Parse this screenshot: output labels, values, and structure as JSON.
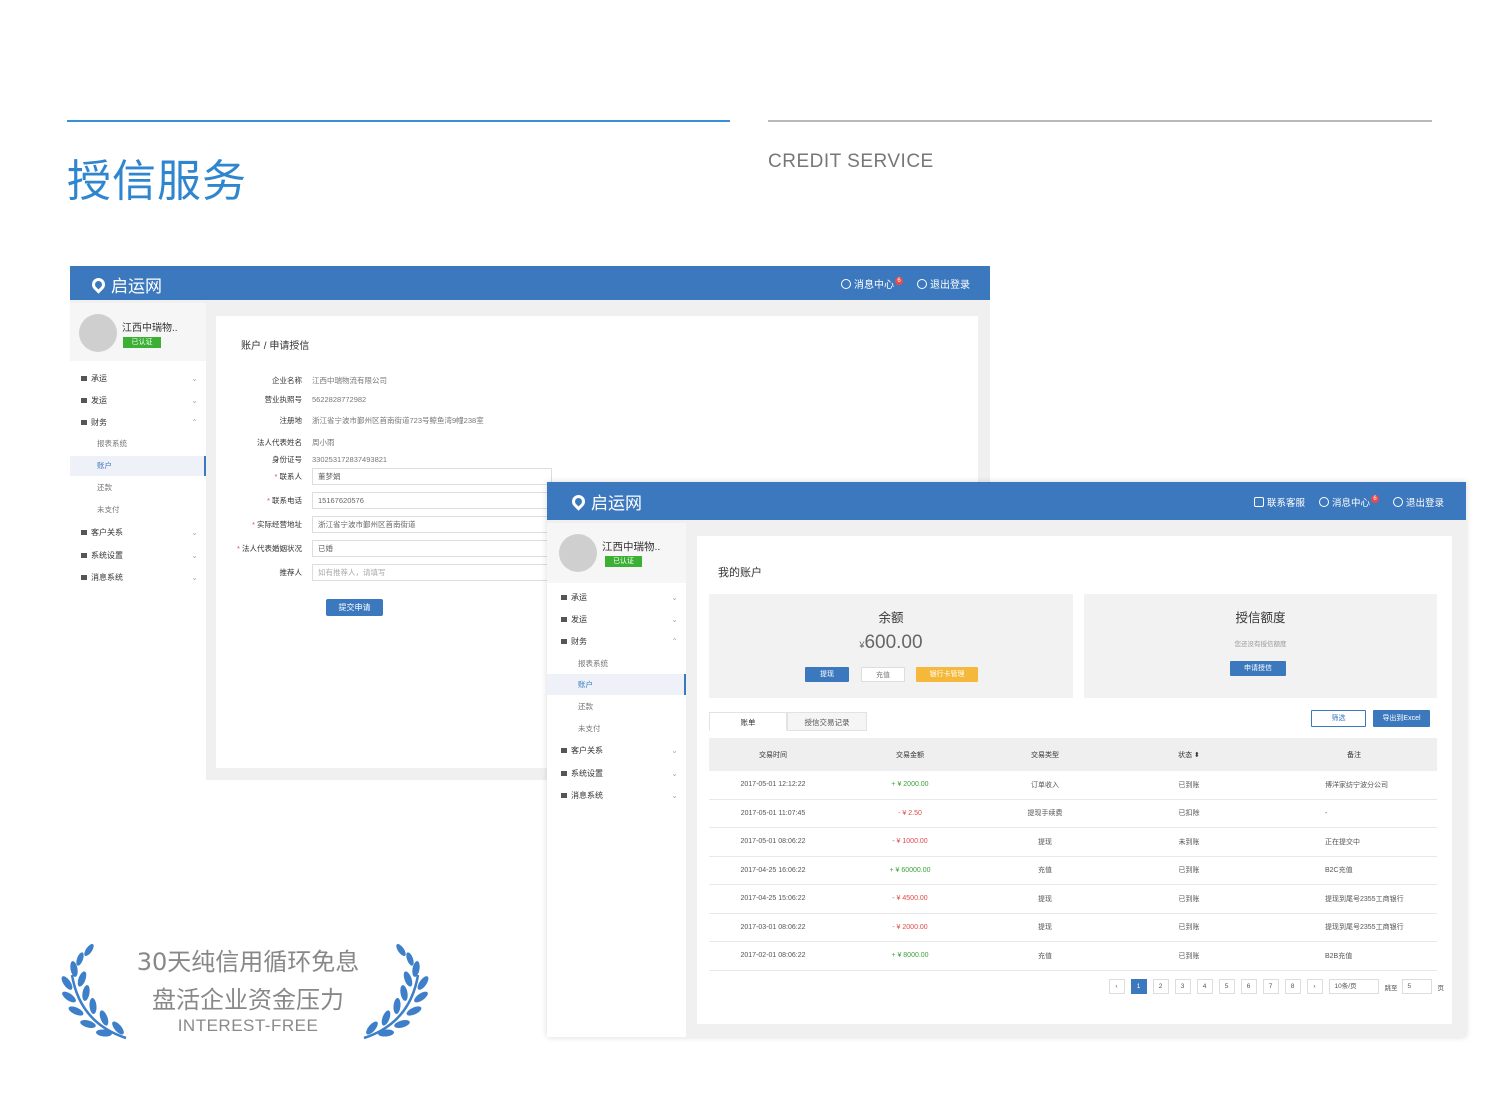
{
  "heading": {
    "title": "授信服务",
    "subtitle": "CREDIT SERVICE"
  },
  "promo": {
    "line1": "30天纯信用循环免息",
    "line2": "盘活企业资金压力",
    "line3": "INTEREST-FREE"
  },
  "brand": {
    "name": "启运网",
    "primary_color": "#3c78be",
    "accent_color": "#2f86cf"
  },
  "window1": {
    "header": {
      "messages_label": "消息中心",
      "messages_badge": "6",
      "logout_label": "退出登录"
    },
    "user": {
      "name": "江西中瑞物..",
      "status": "已认证"
    },
    "nav": [
      {
        "label": "承运",
        "icon": "truck-icon"
      },
      {
        "label": "发运",
        "icon": "list-icon"
      },
      {
        "label": "财务",
        "icon": "finance-icon"
      }
    ],
    "nav_sub": [
      "报表系统",
      "账户",
      "还款",
      "未支付"
    ],
    "nav_more": [
      {
        "label": "客户关系",
        "icon": "customer-icon"
      },
      {
        "label": "系统设置",
        "icon": "gear-icon"
      },
      {
        "label": "消息系统",
        "icon": "message-icon"
      }
    ],
    "breadcrumb": "账户 / 申请授信",
    "form": {
      "company_label": "企业名称",
      "company_value": "江西中瑞物流有限公司",
      "license_label": "营业执照号",
      "license_value": "5622828772982",
      "address_label": "注册地",
      "address_value": "浙江省宁波市鄞州区首南街道723号鲸鱼湾9幢238室",
      "legal_label": "法人代表姓名",
      "legal_value": "周小雨",
      "id_label": "身份证号",
      "id_value": "330253172837493821",
      "contact_label": "联系人",
      "contact_value": "董梦娟",
      "phone_label": "联系电话",
      "phone_value": "15167620576",
      "bizaddr_label": "实际经营地址",
      "bizaddr_value": "浙江省宁波市鄞州区首南街道",
      "marital_label": "法人代表婚姻状况",
      "marital_value": "已婚",
      "referrer_label": "推荐人",
      "referrer_placeholder": "如有推荐人，请填写"
    },
    "submit_label": "提交申请"
  },
  "window2": {
    "header": {
      "service_label": "联系客服",
      "messages_label": "消息中心",
      "messages_badge": "6",
      "logout_label": "退出登录"
    },
    "user": {
      "name": "江西中瑞物..",
      "status": "已认证"
    },
    "nav": [
      {
        "label": "承运",
        "icon": "truck-icon"
      },
      {
        "label": "发运",
        "icon": "list-icon"
      },
      {
        "label": "财务",
        "icon": "finance-icon"
      }
    ],
    "nav_sub": [
      "报表系统",
      "账户",
      "还款",
      "未支付"
    ],
    "nav_more": [
      {
        "label": "客户关系",
        "icon": "customer-icon"
      },
      {
        "label": "系统设置",
        "icon": "gear-icon"
      },
      {
        "label": "消息系统",
        "icon": "message-icon"
      }
    ],
    "title": "我的账户",
    "balance": {
      "title": "余额",
      "currency": "¥",
      "amount": "600.00",
      "withdraw": "提现",
      "recharge": "充值",
      "bank": "银行卡管理"
    },
    "credit": {
      "title": "授信额度",
      "note": "您还没有授信额度",
      "apply": "申请授信"
    },
    "tabs": [
      "账单",
      "授信交易记录"
    ],
    "filter_label": "筛选",
    "export_label": "导出到Excel",
    "columns": [
      "交易时间",
      "交易金额",
      "交易类型",
      "状态 ⬍",
      "备注"
    ],
    "rows": [
      {
        "time": "2017-05-01  12:12:22",
        "amount": "+ ¥ 2000.00",
        "sign": "pos",
        "type": "订单收入",
        "status": "已到账",
        "note": "博洋家纺宁波分公司"
      },
      {
        "time": "2017-05-01  11:07:45",
        "amount": "- ¥ 2.50",
        "sign": "neg",
        "type": "提现手续费",
        "status": "已扣除",
        "note": "-"
      },
      {
        "time": "2017-05-01  08:06:22",
        "amount": "- ¥ 1000.00",
        "sign": "neg",
        "type": "提现",
        "status": "未到账",
        "note": "正在提交中"
      },
      {
        "time": "2017-04-25  16:06:22",
        "amount": "+ ¥ 60000.00",
        "sign": "pos",
        "type": "充值",
        "status": "已到账",
        "note": "B2C充值"
      },
      {
        "time": "2017-04-25  15:06:22",
        "amount": "- ¥ 4500.00",
        "sign": "neg",
        "type": "提现",
        "status": "已到账",
        "note": "提现到尾号2355工商银行"
      },
      {
        "time": "2017-03-01  08:06:22",
        "amount": "- ¥ 2000.00",
        "sign": "neg",
        "type": "提现",
        "status": "已到账",
        "note": "提现到尾号2355工商银行"
      },
      {
        "time": "2017-02-01  08:06:22",
        "amount": "+ ¥ 8000.00",
        "sign": "pos",
        "type": "充值",
        "status": "已到账",
        "note": "B2B充值"
      }
    ],
    "pager": {
      "prev": "‹",
      "pages": [
        "1",
        "2",
        "3",
        "4",
        "5",
        "6",
        "7",
        "8"
      ],
      "next": "›",
      "size": "10条/页",
      "jump_label": "跳至",
      "jump_value": "5",
      "page_unit": "页"
    }
  }
}
